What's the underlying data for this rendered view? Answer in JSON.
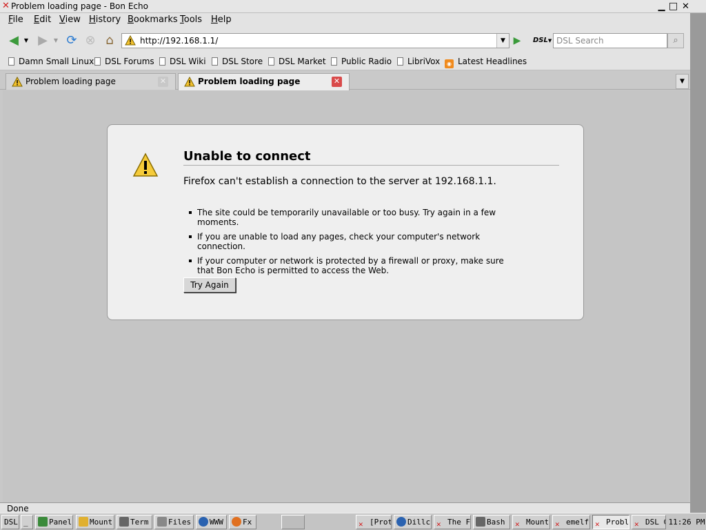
{
  "window": {
    "title": "Problem loading page - Bon Echo",
    "min": "▁",
    "max": "□",
    "close": "✕"
  },
  "menu": {
    "items": [
      {
        "key": "F",
        "rest": "ile"
      },
      {
        "key": "E",
        "rest": "dit"
      },
      {
        "key": "V",
        "rest": "iew"
      },
      {
        "key": "",
        "rest": "History",
        "ul": "H"
      },
      {
        "key": "B",
        "rest": "ookmarks"
      },
      {
        "key": "T",
        "rest": "ools"
      },
      {
        "key": "H",
        "rest": "elp"
      }
    ]
  },
  "nav": {
    "url": "http://192.168.1.1/",
    "search_placeholder": "DSL Search",
    "engine": "DSL"
  },
  "bookmarks": [
    "Damn Small Linux",
    "DSL Forums",
    "DSL Wiki",
    "DSL Store",
    "DSL Market",
    "Public Radio",
    "LibriVox",
    "Latest Headlines"
  ],
  "tabs": [
    {
      "label": "Problem loading page",
      "active": false
    },
    {
      "label": "Problem loading page",
      "active": true
    }
  ],
  "error": {
    "title": "Unable to connect",
    "description": "Firefox can't establish a connection to the server at 192.168.1.1.",
    "bullets": [
      "The site could be temporarily unavailable or too busy. Try again in a few moments.",
      "If you are unable to load any pages, check your computer's network connection.",
      "If your computer or network is protected by a firewall or proxy, make sure that Bon Echo is permitted to access the Web."
    ],
    "button": "Try Again"
  },
  "status": "Done",
  "taskbar": {
    "start": "DSL",
    "sep": "_",
    "items": [
      "Panel",
      "Mount",
      "Term",
      "Files",
      "WWW",
      "Fx",
      "",
      "[Prot",
      "Dillc",
      "The F",
      "Bash",
      "Mount",
      "emelf",
      "Probl",
      "DSL C"
    ],
    "clock": "11:26 PM"
  },
  "colors": {
    "accent_red": "#d21e1e",
    "close_tab": "#d94a4a",
    "go": "#3a9a3a",
    "warn": "#f2c12e"
  }
}
